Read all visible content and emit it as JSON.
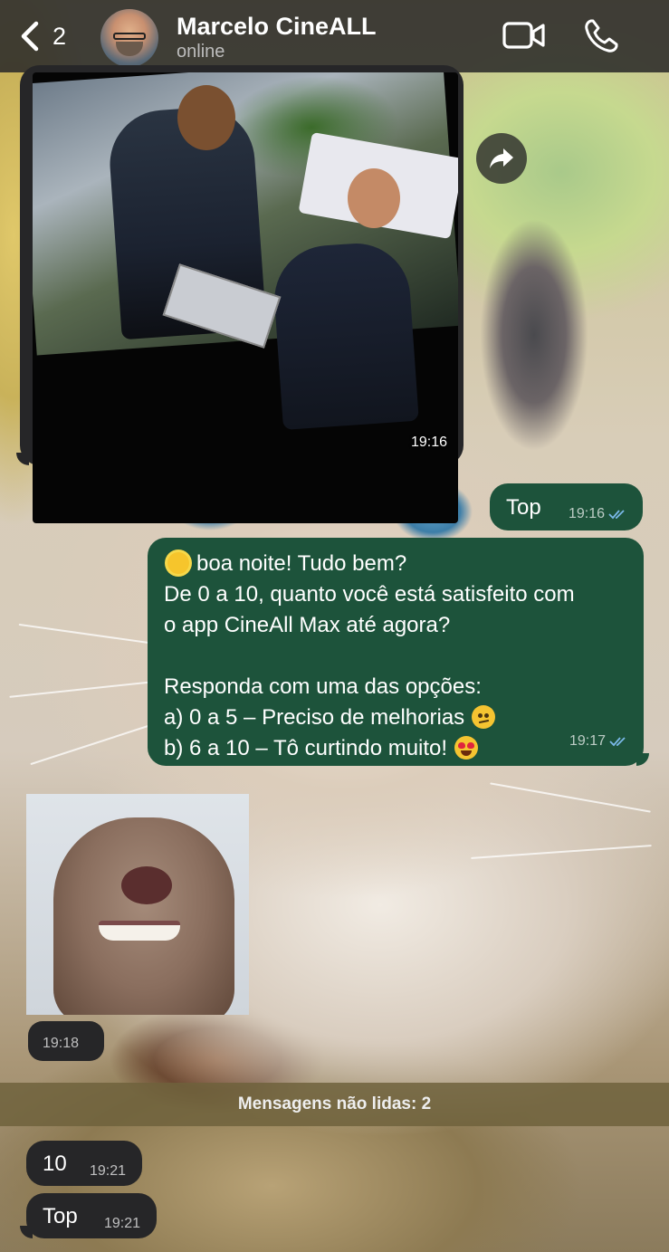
{
  "header": {
    "back_count": "2",
    "contact_name": "Marcelo CineALL",
    "contact_status": "online"
  },
  "messages": [
    {
      "type": "image",
      "direction": "incoming",
      "time": "19:16"
    },
    {
      "type": "text",
      "direction": "outgoing",
      "text": "Top",
      "time": "19:16",
      "read": true
    },
    {
      "type": "text",
      "direction": "outgoing",
      "time": "19:17",
      "read": true,
      "lines": [
        "boa noite! Tudo bem?",
        "De 0 a 10, quanto você está satisfeito com",
        "o app CineAll Max até agora?",
        "",
        "Responda com uma das opções:",
        "a) 0 a 5 – Preciso de melhorias",
        "b) 6 a 10 – Tô curtindo muito!"
      ]
    },
    {
      "type": "sticker",
      "direction": "incoming",
      "time": "19:18"
    },
    {
      "type": "text",
      "direction": "incoming",
      "text": "10",
      "time": "19:21"
    },
    {
      "type": "text",
      "direction": "incoming",
      "text": "Top",
      "time": "19:21"
    }
  ],
  "unread_divider": "Mensagens não lidas: 2",
  "icons": {
    "back": "chevron-left-icon",
    "video": "video-camera-icon",
    "call": "phone-icon",
    "forward": "forward-arrow-icon",
    "ticks": "double-check-icon"
  },
  "colors": {
    "outgoing_bubble": "#1d533b",
    "incoming_bubble": "#262628",
    "read_ticks": "#7ab8e8"
  }
}
